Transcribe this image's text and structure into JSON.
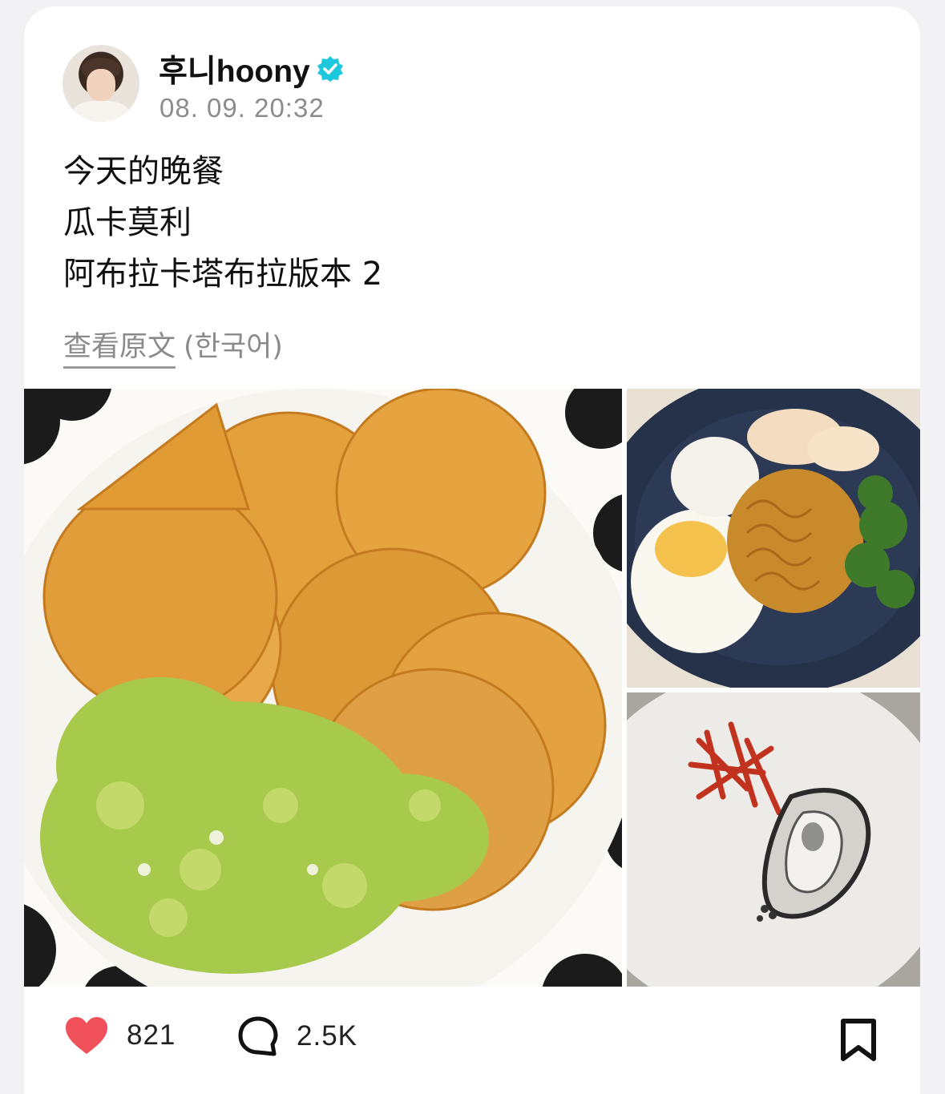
{
  "author": {
    "name": "후니hoony",
    "verified_color": "#1dc7de",
    "timestamp": "08. 09. 20:32"
  },
  "post": {
    "lines": [
      "今天的晚餐",
      "瓜卡莫利",
      "阿布拉卡塔布拉版本 2"
    ],
    "view_original_label": "查看原文",
    "language_note": "(한국어)"
  },
  "photos": [
    {
      "name": "photo-tortilla-chips-guacamole"
    },
    {
      "name": "photo-noodle-bowl"
    },
    {
      "name": "photo-kimchi-oyster-plate"
    }
  ],
  "actions": {
    "likes": "821",
    "comments": "2.5K",
    "like_color": "#f0505a",
    "icons": [
      "heart-icon",
      "comment-icon",
      "bookmark-icon"
    ]
  }
}
